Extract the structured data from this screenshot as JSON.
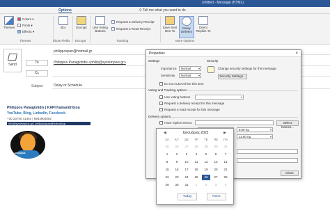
{
  "window": {
    "title": "Untitled - Message (HTML)"
  },
  "tabs": {
    "options": "Options",
    "tell_me": "Tell me what you want to do"
  },
  "ribbon": {
    "themes": "Themes",
    "colors": "Colors",
    "fonts": "Fonts",
    "effects": "Effects",
    "themes_group": "Themes",
    "bcc": "Bcc",
    "show_fields_group": "Show Fields",
    "encrypt": "Encrypt",
    "encrypt_group": "Encrypt",
    "use_voting": "Use Voting Buttons",
    "req_delivery": "Request a Delivery Receipt",
    "req_read": "Request a Read Receipt",
    "tracking_group": "Tracking",
    "save_sent": "Save Sent Item To",
    "delay_delivery": "Delay Delivery",
    "direct_replies": "Direct Replies To",
    "more_options_group": "More Options"
  },
  "message": {
    "send": "Send",
    "from_value": "philippospan@hotmail.gr",
    "to_label": "To",
    "to_value": "Philippos Panagiotidis <philip@systemplus.gr>",
    "cc_label": "Cc",
    "subject_label": "Subject",
    "subject_value": "Delay or Schedule"
  },
  "signature": {
    "name": "Philippos Panagiotidis | KAPI Kamandritsou",
    "links": "YouTube, Blog, LinkedIn, Facebook",
    "phone": "+30 23740 41440 | 6944904062",
    "emails": "info@systemplus.gr | philippospan@hotmail.gr",
    "avatar_text": "philippos"
  },
  "dialog": {
    "title": "Properties",
    "settings": "Settings",
    "security": "Security",
    "importance_label": "Importance",
    "importance_value": "Normal",
    "sensitivity_label": "Sensitivity",
    "sensitivity_value": "Normal",
    "security_text": "Change security settings for this message.",
    "security_settings_btn": "Security Settings...",
    "no_autoarchive": "Do not AutoArchive this item",
    "voting_tracking": "Voting and Tracking options",
    "use_voting": "Use voting buttons",
    "req_delivery": "Request a delivery receipt for this message",
    "req_read": "Request a read receipt for this message",
    "delivery_options": "Delivery options",
    "have_replies": "Have replies sent to",
    "select_names_btn": "Select Names...",
    "do_not_deliver": "Do not deliver before",
    "deliver_date": "26/1/2022",
    "deliver_time": "5:00 πμ",
    "expires_date": "None",
    "expires_time": "12:00 πμ",
    "contacts_btn": "Contacts...",
    "categories_btn": "Categories",
    "close_btn": "Close"
  },
  "calendar": {
    "month": "Ιανουάριος 2022",
    "dow": [
      "ΣΑ",
      "ΚΥ",
      "ΔΕ",
      "ΤΡ",
      "ΤΕ",
      "ΠΕ",
      "ΠΑ"
    ],
    "rows": [
      [
        "25",
        "26",
        "27",
        "28",
        "29",
        "30",
        "31"
      ],
      [
        "1",
        "2",
        "3",
        "4",
        "5",
        "6",
        "7"
      ],
      [
        "8",
        "9",
        "10",
        "11",
        "12",
        "13",
        "14"
      ],
      [
        "15",
        "16",
        "17",
        "18",
        "19",
        "20",
        "21"
      ],
      [
        "22",
        "23",
        "24",
        "25",
        "26",
        "27",
        "28"
      ],
      [
        "29",
        "30",
        "31",
        "1",
        "2",
        "3",
        "4"
      ]
    ],
    "today_btn": "Today",
    "none_btn": "None"
  }
}
